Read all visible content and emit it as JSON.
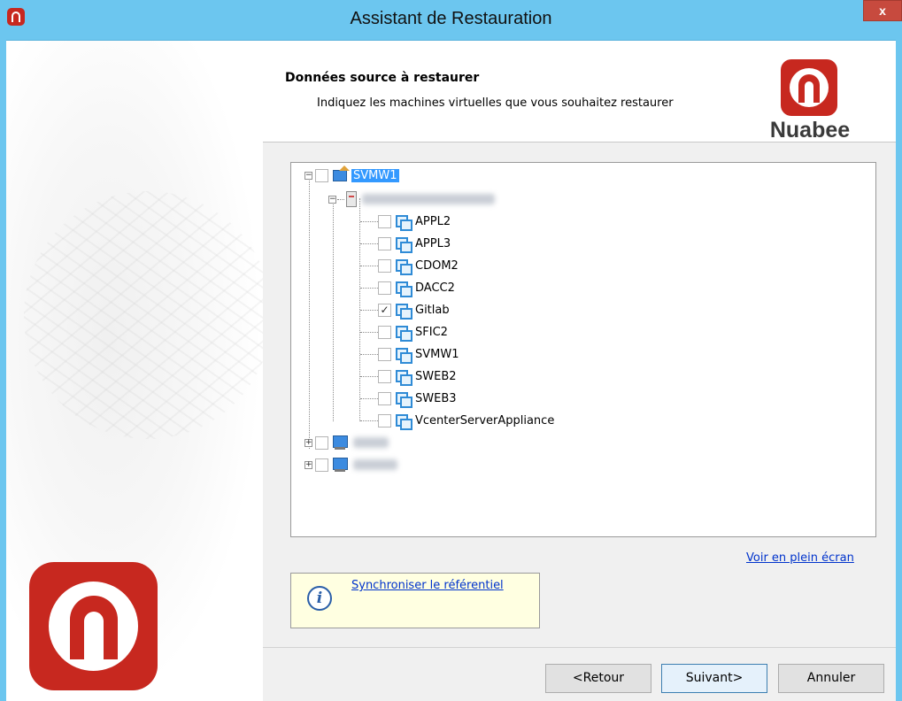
{
  "window": {
    "title": "Assistant de Restauration",
    "close_label": "x"
  },
  "header": {
    "title": "Données source à restaurer",
    "description": "Indiquez les machines virtuelles que vous souhaitez restaurer",
    "brand": "Nuabee"
  },
  "tree": {
    "root_label": "SVMW1",
    "vms": [
      {
        "label": "APPL2",
        "checked": false
      },
      {
        "label": "APPL3",
        "checked": false
      },
      {
        "label": "CDOM2",
        "checked": false
      },
      {
        "label": "DACC2",
        "checked": false
      },
      {
        "label": "Gitlab",
        "checked": true
      },
      {
        "label": "SFIC2",
        "checked": false
      },
      {
        "label": "SVMW1",
        "checked": false
      },
      {
        "label": "SWEB2",
        "checked": false
      },
      {
        "label": "SWEB3",
        "checked": false
      },
      {
        "label": "VcenterServerAppliance",
        "checked": false
      }
    ],
    "check_mark": "✓",
    "collapse_symbol": "−",
    "expand_symbol": "+"
  },
  "links": {
    "fullscreen": "Voir en plein écran",
    "sync": "Synchroniser le référentiel"
  },
  "info_icon": "i",
  "buttons": {
    "back": "<Retour",
    "next": "Suivant>",
    "cancel": "Annuler"
  }
}
